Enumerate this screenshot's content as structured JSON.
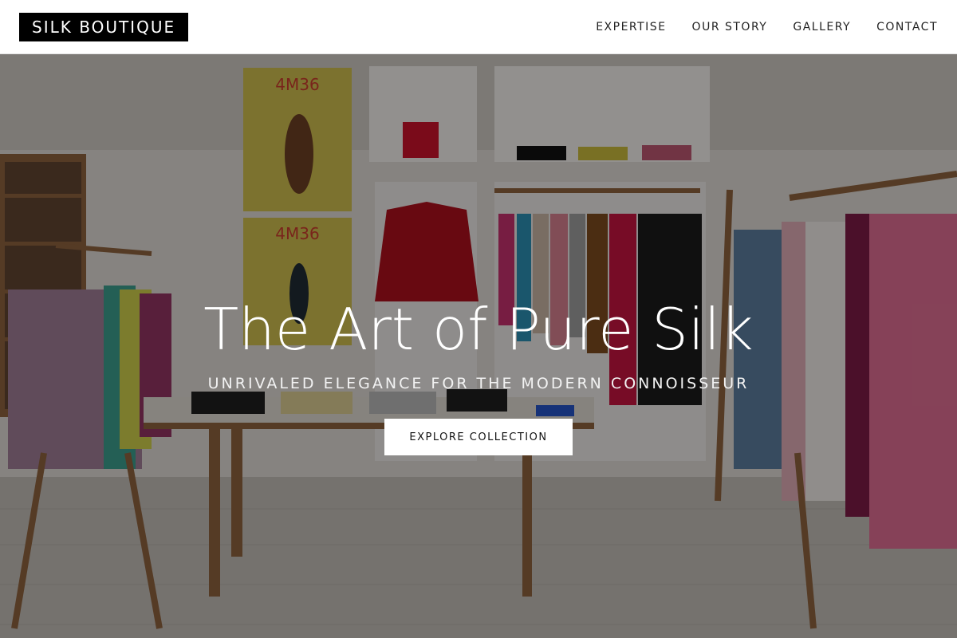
{
  "header": {
    "logo": "SILK BOUTIQUE",
    "nav": [
      {
        "label": "EXPERTISE"
      },
      {
        "label": "OUR STORY"
      },
      {
        "label": "GALLERY"
      },
      {
        "label": "CONTACT"
      }
    ]
  },
  "hero": {
    "title": "The Art of Pure Silk",
    "subtitle": "UNRIVALED ELEGANCE FOR THE MODERN CONNOISSEUR",
    "cta_label": "EXPLORE COLLECTION",
    "photo_signs": [
      "4M36",
      "4M36"
    ]
  },
  "colors": {
    "header_bg": "#ffffff",
    "logo_bg": "#000000",
    "logo_text": "#ffffff",
    "nav_text": "#222222",
    "hero_text": "#ffffff",
    "cta_bg": "#ffffff",
    "cta_text": "#111111"
  }
}
